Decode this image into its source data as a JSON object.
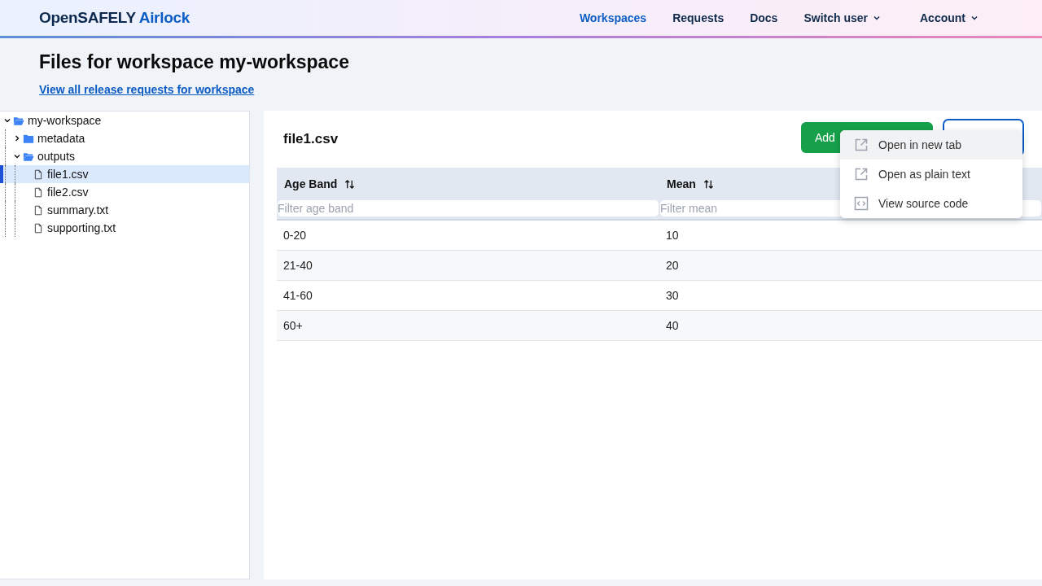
{
  "brand": {
    "name": "OpenSAFELY",
    "product": "Airlock"
  },
  "nav": [
    {
      "label": "Workspaces",
      "selected": true,
      "dropdown": false
    },
    {
      "label": "Requests",
      "selected": false,
      "dropdown": false
    },
    {
      "label": "Docs",
      "selected": false,
      "dropdown": false
    },
    {
      "label": "Switch user",
      "selected": false,
      "dropdown": true
    },
    {
      "label": "Account",
      "selected": false,
      "dropdown": true
    }
  ],
  "page": {
    "title": "Files for workspace my-workspace",
    "link": "View all release requests for workspace"
  },
  "tree": [
    {
      "name": "my-workspace",
      "kind": "folder",
      "expanded": true,
      "selected": false,
      "children": [
        {
          "name": "metadata",
          "kind": "folder",
          "expanded": false,
          "selected": false
        },
        {
          "name": "outputs",
          "kind": "folder",
          "expanded": true,
          "selected": false,
          "children": [
            {
              "name": "file1.csv",
              "kind": "file",
              "selected": true
            },
            {
              "name": "file2.csv",
              "kind": "file",
              "selected": false
            },
            {
              "name": "summary.txt",
              "kind": "file",
              "selected": false
            },
            {
              "name": "supporting.txt",
              "kind": "file",
              "selected": false
            }
          ]
        }
      ]
    }
  ],
  "file": {
    "name": "file1.csv",
    "add_button": "Add"
  },
  "table": {
    "columns": [
      {
        "label": "Age Band",
        "filter_placeholder": "Filter age band"
      },
      {
        "label": "Mean",
        "filter_placeholder": "Filter mean"
      }
    ],
    "rows": [
      [
        "0-20",
        "10"
      ],
      [
        "21-40",
        "20"
      ],
      [
        "41-60",
        "30"
      ],
      [
        "60+",
        "40"
      ]
    ]
  },
  "menu": [
    {
      "label": "Open in new tab",
      "kind": "external",
      "selected": true
    },
    {
      "label": "Open as plain text",
      "kind": "external",
      "selected": false
    },
    {
      "label": "View source code",
      "kind": "code",
      "selected": false
    }
  ]
}
